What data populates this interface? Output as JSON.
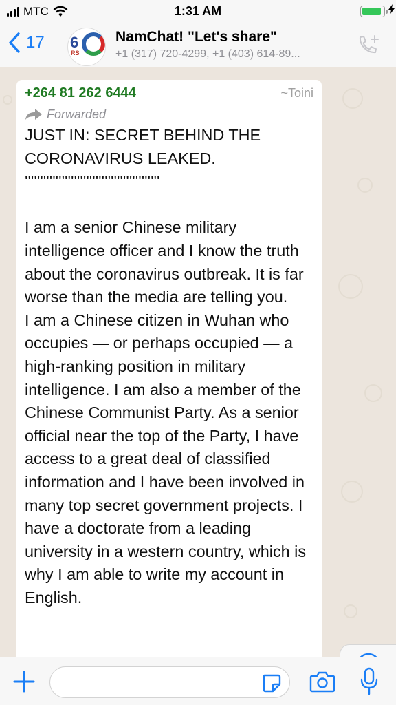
{
  "status_bar": {
    "carrier": "MTC",
    "time": "1:31 AM",
    "battery_level": 0.9,
    "icons": [
      "signal-icon",
      "wifi-icon",
      "battery-icon",
      "charging-icon"
    ]
  },
  "header": {
    "back_count": "17",
    "avatar_text": "6",
    "avatar_sub": "RS",
    "title": "NamChat! \"Let's share\"",
    "subtitle": "+1 (317) 720-4299, +1 (403) 614-89..."
  },
  "message": {
    "sender_number": "+264 81 262 6444",
    "sender_name": "~Toini",
    "forwarded_label": "Forwarded",
    "text": "JUST IN: SECRET BEHIND THE CORONAVIRUS LEAKED.\n''''''''''''''''''''''''''''''''''''''''''''\n\nI am a senior Chinese military intelligence officer and I know the truth about the coronavirus outbreak. It is far worse than the media are telling you.\nI am a Chinese citizen in Wuhan who occupies — or perhaps occupied — a high-ranking position in military intelligence. I am also a member of the Chinese Communist Party. As a senior official near the top of the Party, I have access to a great deal of classified information and I have been involved in many top secret government projects. I have a doctorate from a leading university in a western country, which is why I am able to write my account in English."
  },
  "input_bar": {
    "placeholder": ""
  },
  "colors": {
    "accent": "#1a7ef6",
    "sender_green": "#1f7a22",
    "chat_bg": "#ece5dd",
    "bar_bg": "#f7f7f7"
  }
}
